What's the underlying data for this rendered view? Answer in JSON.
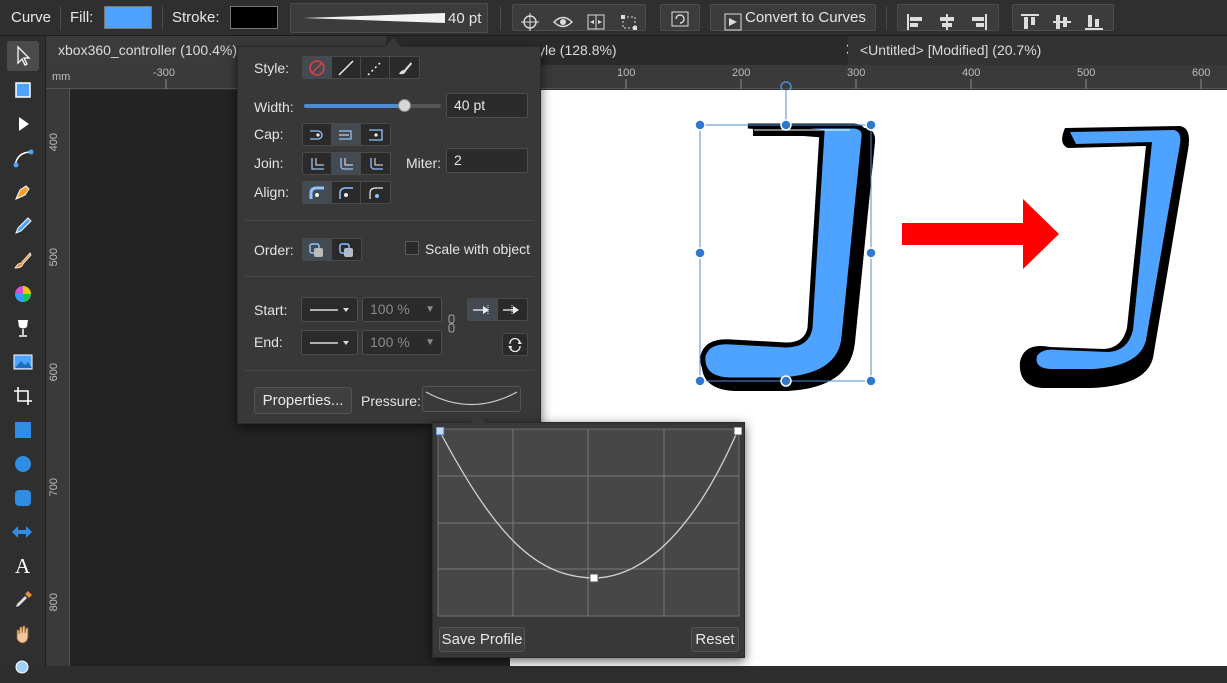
{
  "toolbar": {
    "tool_name": "Curve",
    "fill_label": "Fill:",
    "fill_color": "#4da3ff",
    "stroke_label": "Stroke:",
    "stroke_color": "#000000",
    "stroke_width": "40 pt",
    "convert_to_curves": "Convert to Curves"
  },
  "tabs": [
    {
      "label": "xbox360_controller (100.4%)"
    },
    {
      "label": "yle (128.8%)"
    },
    {
      "label": "<Untitled> [Modified] (20.7%)"
    }
  ],
  "ruler": {
    "unit": "mm",
    "h_ticks": [
      "-300",
      "100",
      "200",
      "300",
      "400",
      "500",
      "600"
    ],
    "v_ticks": [
      "400",
      "500",
      "600",
      "700",
      "800"
    ]
  },
  "stroke_panel": {
    "style_label": "Style:",
    "width_label": "Width:",
    "width_value": "40 pt",
    "width_fraction": 0.73,
    "cap_label": "Cap:",
    "join_label": "Join:",
    "miter_label": "Miter:",
    "miter_value": "2",
    "align_label": "Align:",
    "order_label": "Order:",
    "scale_with_object": "Scale with object",
    "start_label": "Start:",
    "end_label": "End:",
    "start_scale": "100 %",
    "end_scale": "100 %",
    "properties_button": "Properties...",
    "pressure_label": "Pressure:"
  },
  "pressure_popup": {
    "save_profile": "Save Profile",
    "reset": "Reset"
  },
  "canvas": {
    "arrow_color": "#ff0000",
    "glyph_fill": "#4da3ff"
  }
}
